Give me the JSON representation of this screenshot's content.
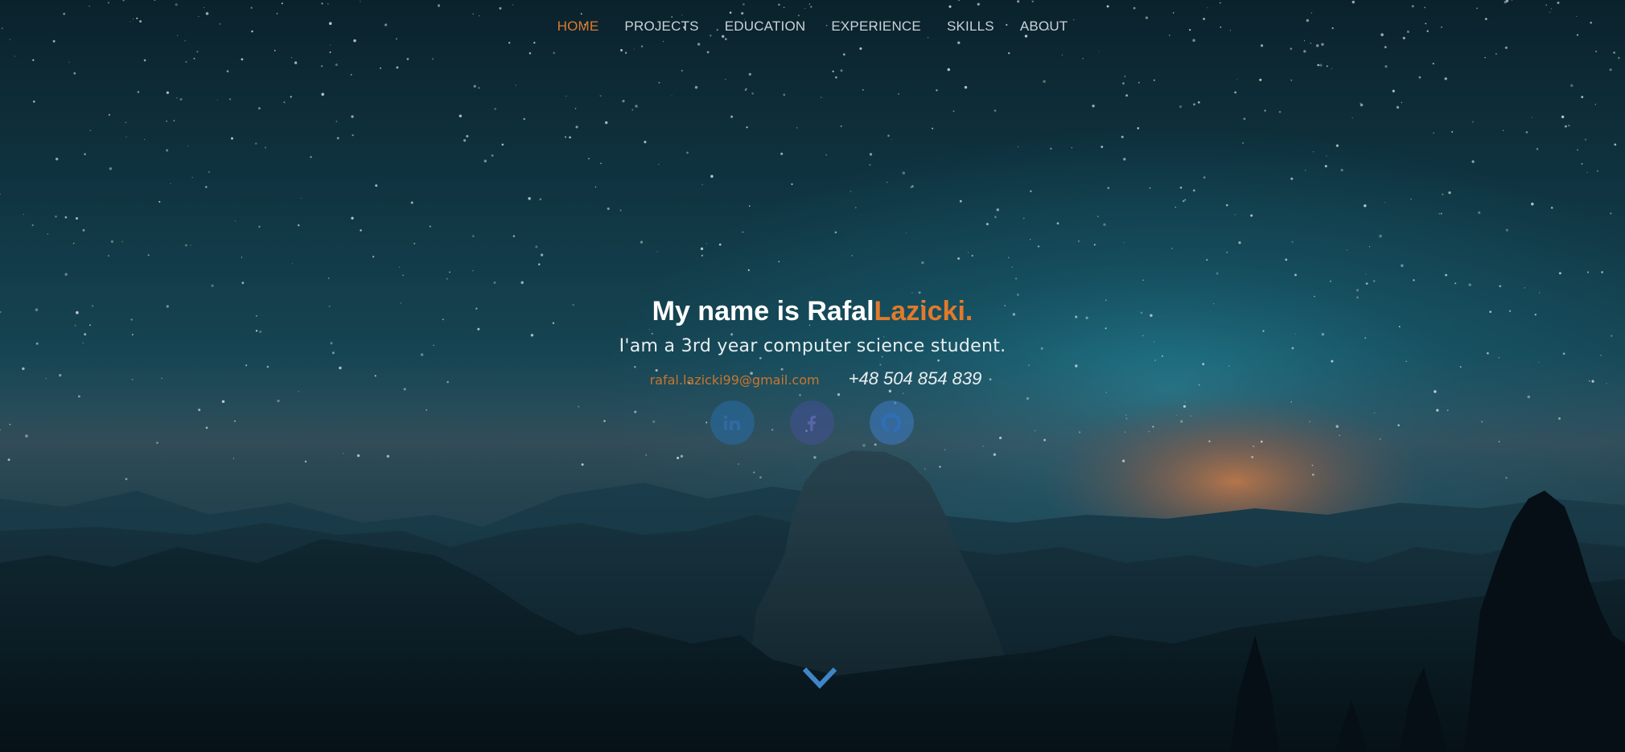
{
  "nav": {
    "items": [
      {
        "label": "HOME",
        "active": true
      },
      {
        "label": "PROJECTS",
        "active": false
      },
      {
        "label": "EDUCATION",
        "active": false
      },
      {
        "label": "EXPERIENCE",
        "active": false
      },
      {
        "label": "SKILLS",
        "active": false
      },
      {
        "label": "ABOUT",
        "active": false
      }
    ]
  },
  "hero": {
    "headline_prefix": "My name is Rafal",
    "headline_accent": "Lazicki.",
    "tagline": "I'am a 3rd year computer science student.",
    "email": "rafal.lazicki99@gmail.com",
    "phone": "+48 504 854 839"
  },
  "socials": [
    {
      "icon": "linkedin-icon"
    },
    {
      "icon": "facebook-icon"
    },
    {
      "icon": "github-icon"
    }
  ],
  "scroll": {
    "icon": "chevron-down-icon"
  },
  "colors": {
    "accent": "#e07a2c",
    "nav_text": "#c9d3d8",
    "chevron": "#3f86c8"
  }
}
